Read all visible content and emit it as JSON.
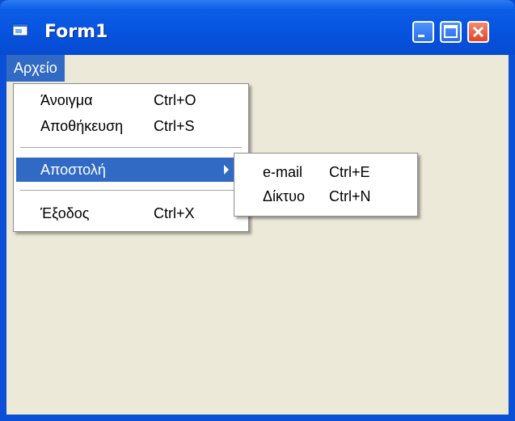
{
  "window": {
    "title": "Form1"
  },
  "menubar": {
    "file_label": "Αρχείο"
  },
  "file_menu": {
    "items": [
      {
        "label": "Άνοιγμα",
        "shortcut": "Ctrl+O"
      },
      {
        "label": "Αποθήκευση",
        "shortcut": "Ctrl+S"
      },
      {
        "label": "Αποστολή",
        "shortcut": ""
      },
      {
        "label": "Έξοδος",
        "shortcut": "Ctrl+X"
      }
    ]
  },
  "send_submenu": {
    "items": [
      {
        "label": "e-mail",
        "shortcut": "Ctrl+E"
      },
      {
        "label": "Δίκτυο",
        "shortcut": "Ctrl+N"
      }
    ]
  },
  "colors": {
    "titlebar": "#0754e0",
    "client": "#ece9d8",
    "highlight": "#316ac5"
  },
  "icons": {
    "app": "app-window-icon",
    "minimize": "minimize-icon",
    "maximize": "maximize-icon",
    "close": "close-icon",
    "submenu_arrow": "chevron-right-icon"
  }
}
